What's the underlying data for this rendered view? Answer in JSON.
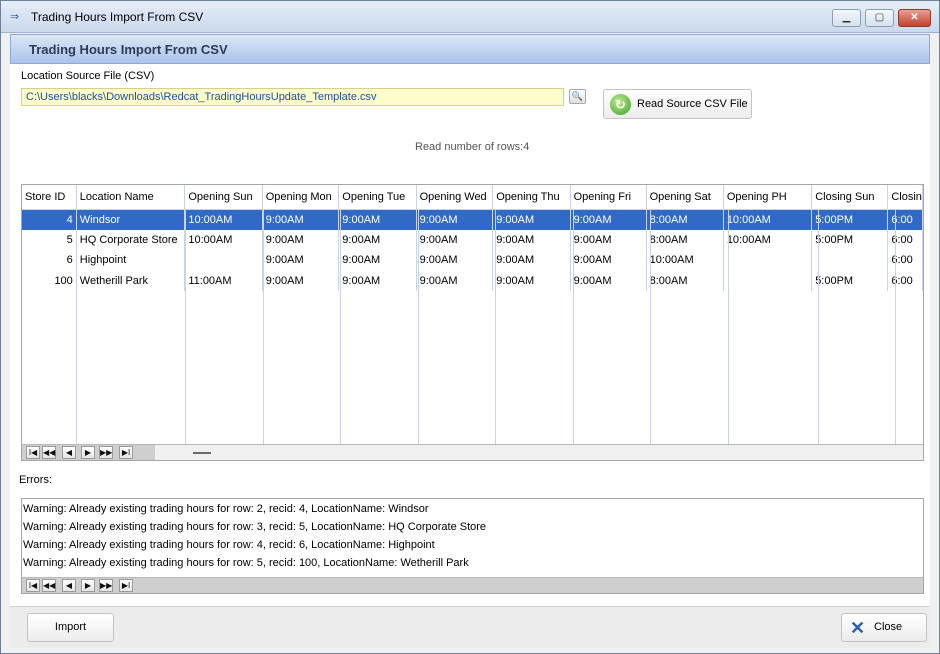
{
  "window": {
    "title": "Trading Hours Import From CSV",
    "header_title": "Trading Hours Import From CSV",
    "min_glyph": "▁",
    "max_glyph": "▢",
    "close_glyph": "✕"
  },
  "source": {
    "label": "Location Source File (CSV)",
    "file_path": "C:\\Users\\blacks\\Downloads\\Redcat_TradingHoursUpdate_Template.csv",
    "browse_glyph": "🔍",
    "read_button_label": "Read Source CSV File",
    "read_icon_glyph": "↻"
  },
  "status": {
    "rows_read": "Read number of rows:4"
  },
  "grid": {
    "columns": [
      "Store ID",
      "Location Name",
      "Opening Sun",
      "Opening Mon",
      "Opening Tue",
      "Opening Wed",
      "Opening Thu",
      "Opening Fri",
      "Opening Sat",
      "Opening PH",
      "Closing Sun",
      "Closin"
    ],
    "rows": [
      [
        "4",
        "Windsor",
        "10:00AM",
        "9:00AM",
        "9:00AM",
        "9:00AM",
        "9:00AM",
        "9:00AM",
        "8:00AM",
        "10:00AM",
        "5:00PM",
        "6:00"
      ],
      [
        "5",
        "HQ Corporate Store",
        "10:00AM",
        "9:00AM",
        "9:00AM",
        "9:00AM",
        "9:00AM",
        "9:00AM",
        "8:00AM",
        "10:00AM",
        "5:00PM",
        "6:00"
      ],
      [
        "6",
        "Highpoint",
        "",
        "9:00AM",
        "9:00AM",
        "9:00AM",
        "9:00AM",
        "9:00AM",
        "10:00AM",
        "",
        "",
        "6:00"
      ],
      [
        "100",
        "Wetherill Park",
        "11:00AM",
        "9:00AM",
        "9:00AM",
        "9:00AM",
        "9:00AM",
        "9:00AM",
        "8:00AM",
        "",
        "5:00PM",
        "6:00"
      ]
    ],
    "selected_row": 0
  },
  "navigator": {
    "first": "I◀",
    "prev_page": "◀◀",
    "prev": "◀",
    "next": "▶",
    "next_page": "▶▶",
    "last": "▶I"
  },
  "errors": {
    "label": "Errors:",
    "lines": [
      "Warning: Already existing trading hours for row: 2, recid: 4, LocationName: Windsor",
      "Warning: Already existing trading hours for row: 3, recid: 5, LocationName: HQ Corporate Store",
      "Warning: Already existing trading hours for row: 4, recid: 6, LocationName: Highpoint",
      "Warning: Already existing trading hours for row: 5, recid: 100, LocationName: Wetherill Park"
    ]
  },
  "buttons": {
    "import": "Import",
    "close": "Close",
    "close_icon_glyph": "✕"
  }
}
